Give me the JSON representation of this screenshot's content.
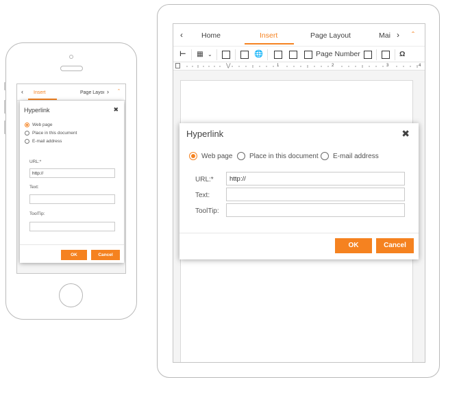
{
  "accent_color": "#f58220",
  "phone": {
    "tabs": {
      "prev_icon": "chevron-left-icon",
      "insert": "Insert",
      "page_layout": "Page Layoı",
      "next_icon": "chevron-right-icon",
      "collapse_icon": "chevron-up-icon"
    },
    "dialog": {
      "title": "Hyperlink",
      "close_icon": "close-icon",
      "options": [
        "Web page",
        "Place in this document",
        "E-mail address"
      ],
      "selected_option": "Web page",
      "url_label": "URL:*",
      "url_value": "http://",
      "text_label": "Text:",
      "text_value": "",
      "tooltip_label": "ToolTip:",
      "tooltip_value": "",
      "ok_label": "OK",
      "cancel_label": "Cancel"
    }
  },
  "tablet": {
    "tabs": {
      "prev_icon": "chevron-left-icon",
      "home": "Home",
      "insert": "Insert",
      "page_layout": "Page Layout",
      "mailings": "Mai",
      "next_icon": "chevron-right-icon",
      "collapse_icon": "chevron-up-icon"
    },
    "toolbar": {
      "icons": [
        "page-break-icon",
        "table-icon",
        "picture-icon",
        "text-box-icon",
        "hyperlink-icon",
        "header-icon",
        "footer-icon",
        "page-number-icon",
        "page-count-icon",
        "field-icon",
        "symbol-icon"
      ],
      "page_number_label": "Page Number",
      "symbol_glyph": "Ω"
    },
    "ruler": {
      "numbers": [
        "1",
        "2",
        "3",
        "4"
      ]
    },
    "dialog": {
      "title": "Hyperlink",
      "close_icon": "close-icon",
      "options": [
        "Web page",
        "Place in this document",
        "E-mail address"
      ],
      "selected_option": "Web page",
      "url_label": "URL:*",
      "url_value": "http://",
      "text_label": "Text:",
      "text_value": "",
      "tooltip_label": "ToolTip:",
      "tooltip_value": "",
      "ok_label": "OK",
      "cancel_label": "Cancel"
    }
  }
}
